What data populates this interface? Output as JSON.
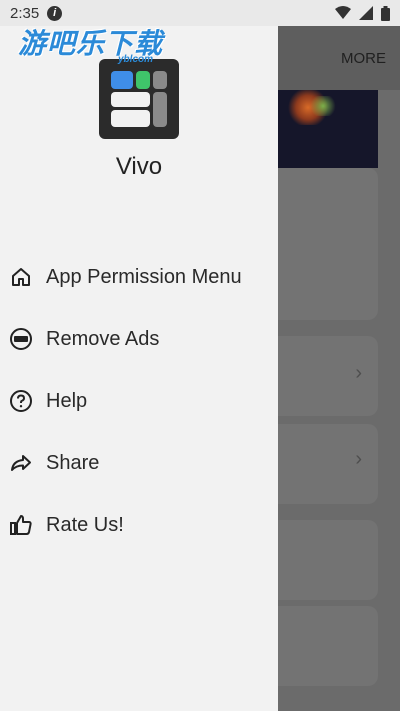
{
  "status_bar": {
    "time": "2:35"
  },
  "watermark": {
    "brand": "游吧乐下载",
    "domain": "yblcom"
  },
  "background_app": {
    "more_label": "MORE"
  },
  "drawer": {
    "app_name": "Vivo",
    "menu": [
      {
        "label": "App Permission Menu",
        "icon": "home-icon"
      },
      {
        "label": "Remove Ads",
        "icon": "ads-icon"
      },
      {
        "label": "Help",
        "icon": "help-icon"
      },
      {
        "label": "Share",
        "icon": "share-icon"
      },
      {
        "label": "Rate Us!",
        "icon": "thumbs-up-icon"
      }
    ]
  },
  "colors": {
    "drawer_bg": "#f2f2f2",
    "scrim": "#7a7a7a",
    "watermark": "#2b8ad8"
  }
}
